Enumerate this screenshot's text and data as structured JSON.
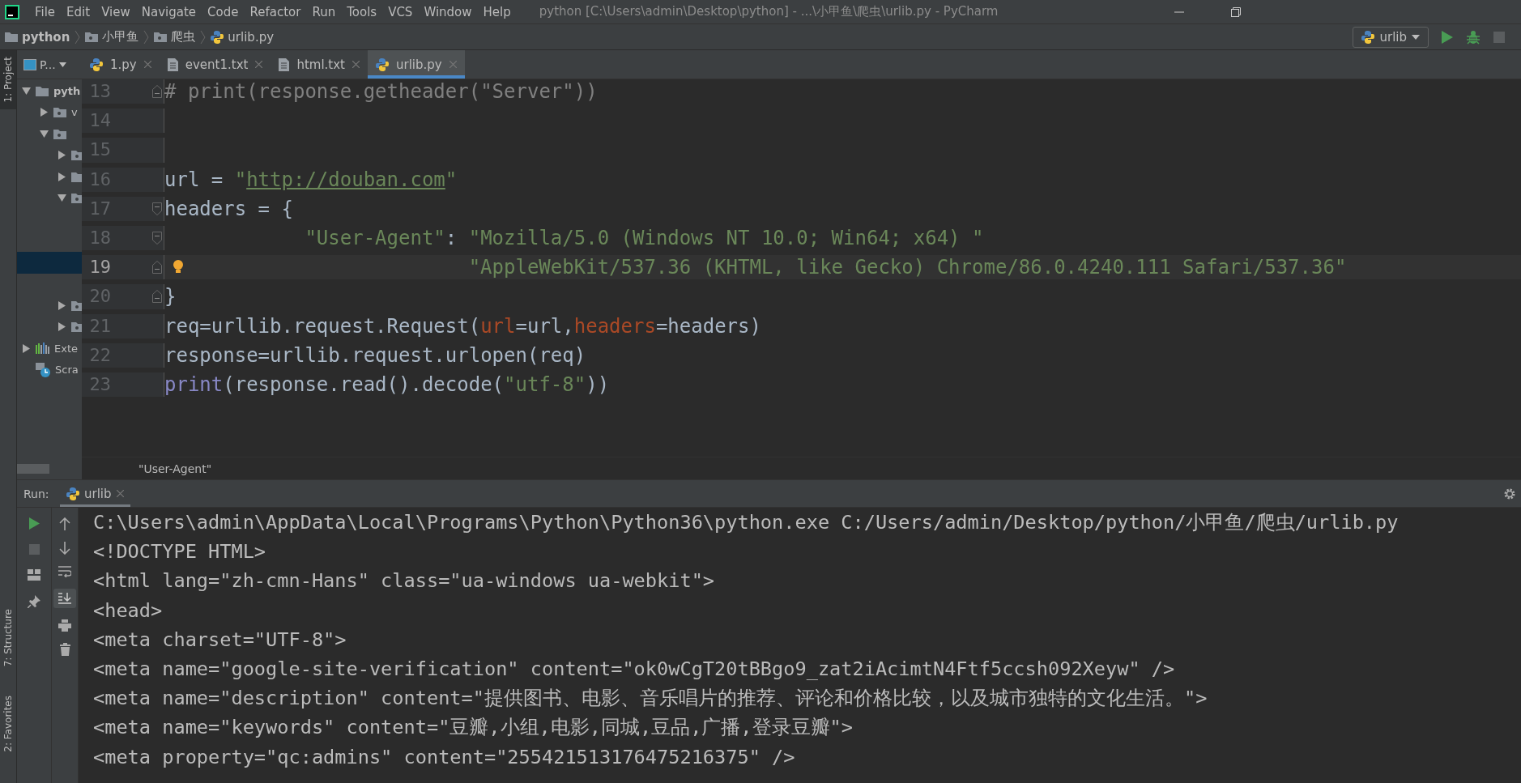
{
  "window": {
    "title": "python [C:\\Users\\admin\\Desktop\\python] - ...\\小甲鱼\\爬虫\\urlib.py - PyCharm"
  },
  "menu": [
    "File",
    "Edit",
    "View",
    "Navigate",
    "Code",
    "Refactor",
    "Run",
    "Tools",
    "VCS",
    "Window",
    "Help"
  ],
  "breadcrumb": [
    {
      "label": "python",
      "kind": "folder"
    },
    {
      "label": "小甲鱼",
      "kind": "package"
    },
    {
      "label": "爬虫",
      "kind": "package"
    },
    {
      "label": "urlib.py",
      "kind": "python"
    }
  ],
  "run_config": {
    "label": "urlib"
  },
  "tool_stripe": {
    "top": [
      {
        "label": "1: Project",
        "selected": true
      }
    ],
    "bottom": [
      {
        "label": "7: Structure",
        "selected": false
      },
      {
        "label": "2: Favorites",
        "selected": false
      }
    ]
  },
  "project": {
    "selector": "P...",
    "tree": [
      {
        "label": "pyth",
        "kind": "folder",
        "expanded": true,
        "selected": false,
        "children": [
          {
            "label": "v",
            "kind": "package",
            "expanded": false,
            "selected": false
          },
          {
            "kind": "package",
            "expanded": true,
            "selected": false,
            "children": [
              {
                "kind": "package",
                "expanded": false,
                "selected": false
              },
              {
                "kind": "folder",
                "expanded": false,
                "selected": false
              },
              {
                "kind": "package",
                "expanded": true,
                "selected": false,
                "children": [
                  {
                    "selected": false
                  },
                  {
                    "selected": false
                  },
                  {
                    "selected": true
                  },
                  {
                    "selected": false
                  }
                ]
              },
              {
                "kind": "package",
                "expanded": false,
                "selected": false
              },
              {
                "kind": "package",
                "expanded": false,
                "selected": false
              }
            ]
          }
        ]
      },
      {
        "label": "Exte",
        "kind": "libraries",
        "expanded": false,
        "selected": false
      },
      {
        "label": "Scra",
        "kind": "scratches",
        "selected": false
      }
    ]
  },
  "tabs": [
    {
      "label": "1.py",
      "kind": "python",
      "selected": false
    },
    {
      "label": "event1.txt",
      "kind": "text",
      "selected": false
    },
    {
      "label": "html.txt",
      "kind": "text",
      "selected": false
    },
    {
      "label": "urlib.py",
      "kind": "python",
      "selected": true
    }
  ],
  "editor": {
    "lines": [
      {
        "number": "13",
        "current": false,
        "fold_end": true,
        "tokens": [
          {
            "kind": "comment",
            "text": "# print(response.getheader(\"Server\"))"
          }
        ]
      },
      {
        "number": "14",
        "current": false
      },
      {
        "number": "15",
        "current": false
      },
      {
        "number": "16",
        "current": false,
        "tokens": [
          {
            "kind": "plain",
            "text": "url = "
          },
          {
            "kind": "string",
            "text": "\""
          },
          {
            "kind": "link",
            "text": "http://douban.com"
          },
          {
            "kind": "string",
            "text": "\""
          }
        ]
      },
      {
        "number": "17",
        "current": false,
        "fold_start": true,
        "tokens": [
          {
            "kind": "plain",
            "text": "headers = {"
          }
        ]
      },
      {
        "number": "18",
        "current": false,
        "fold_start": true,
        "indented": true,
        "tokens": [
          {
            "kind": "string",
            "text": "\"User-Agent\""
          },
          {
            "kind": "plain",
            "text": ": "
          },
          {
            "kind": "string",
            "text": "\"Mozilla/5.0 (Windows NT 10.0; Win64; x64) \""
          }
        ]
      },
      {
        "number": "19",
        "current": true,
        "fold_end": true,
        "continuation": true,
        "tokens": [
          {
            "kind": "string",
            "text": "\"AppleWebKit/537.36 (KHTML, like Gecko) Chrome/86.0.4240.111 Safari/537.36\""
          }
        ]
      },
      {
        "number": "20",
        "current": false,
        "fold_end": true,
        "tokens": [
          {
            "kind": "plain",
            "text": "}"
          }
        ]
      },
      {
        "number": "21",
        "current": false,
        "tokens": [
          {
            "kind": "plain",
            "text": "req=urllib.request.Request("
          },
          {
            "kind": "param",
            "text": "url"
          },
          {
            "kind": "plain",
            "text": "=url,"
          },
          {
            "kind": "param",
            "text": "headers"
          },
          {
            "kind": "plain",
            "text": "=headers)"
          }
        ]
      },
      {
        "number": "22",
        "current": false,
        "tokens": [
          {
            "kind": "plain",
            "text": "response=urllib.request.urlopen(req)"
          }
        ]
      },
      {
        "number": "23",
        "current": false,
        "tokens": [
          {
            "kind": "builtin",
            "text": "print"
          },
          {
            "kind": "plain",
            "text": "(response.read().decode("
          },
          {
            "kind": "string",
            "text": "\"utf-8\""
          },
          {
            "kind": "plain",
            "text": "))"
          }
        ]
      }
    ],
    "breadcrumb": "\"User-Agent\""
  },
  "run": {
    "label": "Run:",
    "tabs": [
      {
        "label": "urlib",
        "selected": true
      }
    ],
    "console": [
      "C:\\Users\\admin\\AppData\\Local\\Programs\\Python\\Python36\\python.exe C:/Users/admin/Desktop/python/小甲鱼/爬虫/urlib.py",
      "<!DOCTYPE HTML>",
      "<html lang=\"zh-cmn-Hans\" class=\"ua-windows ua-webkit\">",
      "<head>",
      "<meta charset=\"UTF-8\">",
      "<meta name=\"google-site-verification\" content=\"ok0wCgT20tBBgo9_zat2iAcimtN4Ftf5ccsh092Xeyw\" />",
      "<meta name=\"description\" content=\"提供图书、电影、音乐唱片的推荐、评论和价格比较，以及城市独特的文化生活。\">",
      "<meta name=\"keywords\" content=\"豆瓣,小组,电影,同城,豆品,广播,登录豆瓣\">",
      "<meta property=\"qc:admins\" content=\"255421513176475216375\" />"
    ]
  }
}
